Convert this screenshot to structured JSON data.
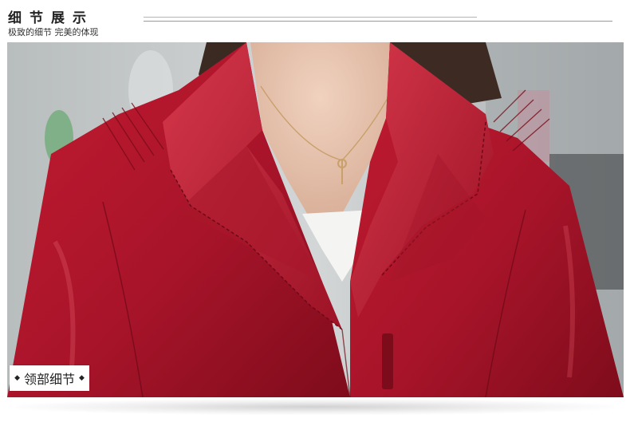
{
  "header": {
    "title": "细节展示",
    "subtitle": "极致的细节 完美的体现"
  },
  "photo": {
    "subject": "red-leather-jacket-collar-detail",
    "colors": {
      "jacket": "#b0152a",
      "jacket_dark": "#7e0c1b",
      "jacket_light": "#d23a48",
      "skin": "#e6c3ae",
      "hair": "#3a2a22",
      "shirt": "#f4f4f2",
      "background": "#bfc3c4"
    }
  },
  "caption": {
    "label": "领部细节",
    "left_icon": "diamond-icon",
    "right_icon": "diamond-icon"
  }
}
